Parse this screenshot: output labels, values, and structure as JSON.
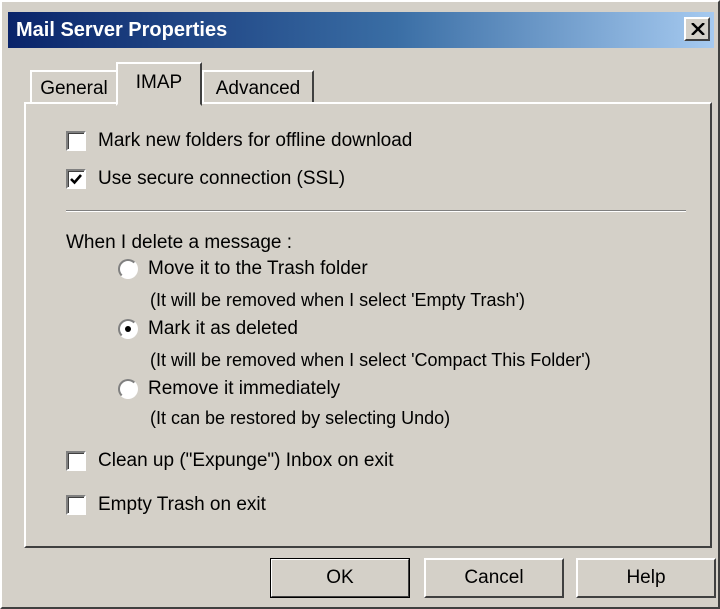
{
  "window": {
    "title": "Mail Server Properties",
    "close_label": "close"
  },
  "tabs": [
    {
      "label": "General",
      "active": false
    },
    {
      "label": "IMAP",
      "active": true
    },
    {
      "label": "Advanced",
      "active": false
    }
  ],
  "options": {
    "mark_offline": {
      "label": "Mark new folders for offline download",
      "checked": false
    },
    "use_ssl": {
      "label": "Use secure connection (SSL)",
      "checked": true
    }
  },
  "delete_group": {
    "heading": "When I delete a message :",
    "choices": [
      {
        "label": "Move it to the Trash folder",
        "hint": "(It will be removed when I select 'Empty Trash')",
        "selected": false
      },
      {
        "label": "Mark it as deleted",
        "hint": "(It will be removed when I select 'Compact This Folder')",
        "selected": true
      },
      {
        "label": "Remove it immediately",
        "hint": "(It can be restored by selecting Undo)",
        "selected": false
      }
    ]
  },
  "exit_options": {
    "expunge": {
      "label": "Clean up (\"Expunge\") Inbox on exit",
      "checked": false
    },
    "empty_trash": {
      "label": "Empty Trash on exit",
      "checked": false
    }
  },
  "buttons": {
    "ok": "OK",
    "cancel": "Cancel",
    "help": "Help"
  },
  "colors": {
    "face": "#d4d0c8",
    "title_start": "#0a246a",
    "title_end": "#a6caf0"
  }
}
